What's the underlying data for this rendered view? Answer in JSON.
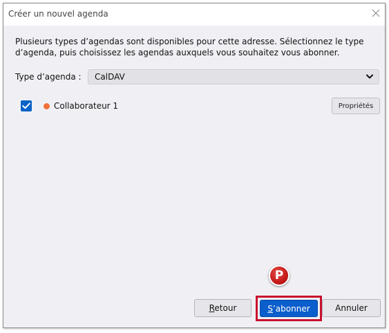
{
  "dialog": {
    "title": "Créer un nouvel agenda",
    "description": "Plusieurs types d’agendas sont disponibles pour cette adresse. Sélectionnez le type d’agenda, puis choisissez les agendas auxquels vous souhaitez vous abonner."
  },
  "calendar_type": {
    "label": "Type d’agenda :",
    "selected": "CalDAV"
  },
  "calendars": [
    {
      "name": "Collaborateur 1",
      "checked": true,
      "color": "#f0713a",
      "properties_label": "Propriétés"
    }
  ],
  "badge": {
    "letter": "P"
  },
  "buttons": {
    "retour_first": "R",
    "retour_rest": "etour",
    "sabonner_first": "S",
    "sabonner_rest": "’abonner",
    "annuler": "Annuler"
  },
  "colors": {
    "accent": "#0b5ecb",
    "highlight": "#c8102e",
    "badge": "#c41a1a"
  },
  "icons": {
    "close": "close-icon",
    "chevron": "chevron-down-icon",
    "check": "checkmark-icon"
  }
}
